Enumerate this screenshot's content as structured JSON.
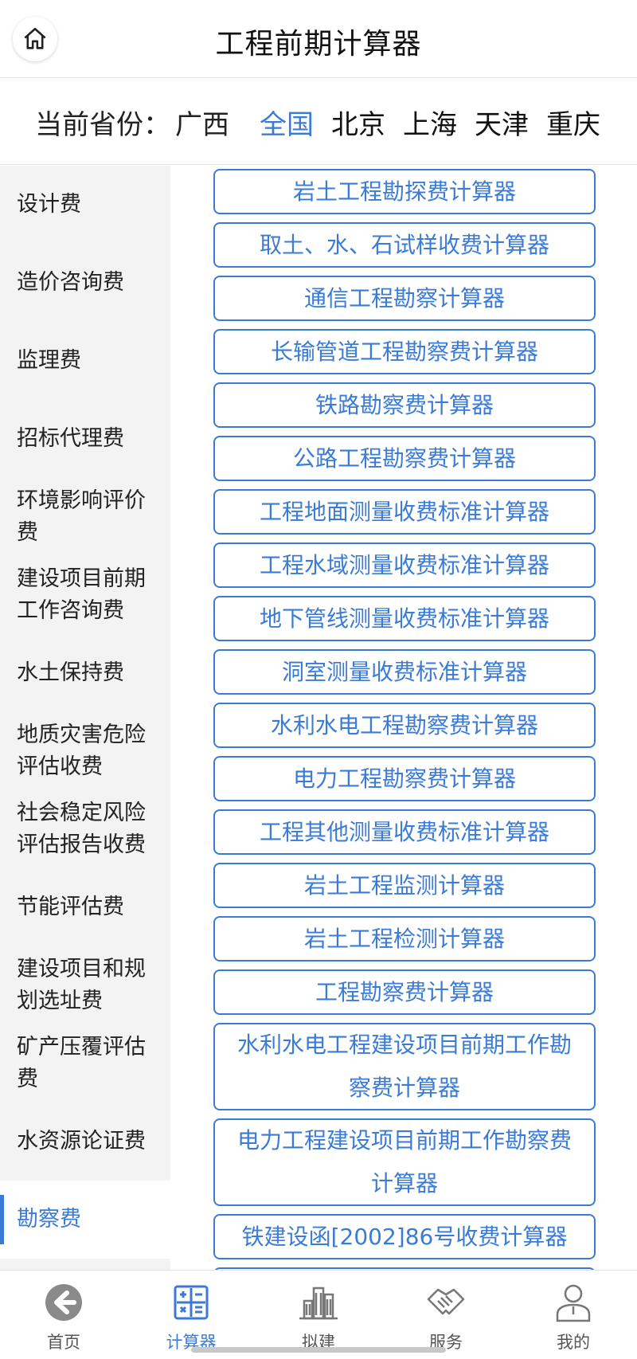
{
  "header": {
    "title": "工程前期计算器",
    "home_icon": "home-icon"
  },
  "province": {
    "label": "当前省份：",
    "current": "广西",
    "options": [
      "全国",
      "北京",
      "上海",
      "天津",
      "重庆"
    ],
    "active_option": "全国"
  },
  "sidebar": {
    "items": [
      {
        "label": "设计费"
      },
      {
        "label": "造价咨询费"
      },
      {
        "label": "监理费"
      },
      {
        "label": "招标代理费"
      },
      {
        "label": "环境影响评价费"
      },
      {
        "label": "建设项目前期工作咨询费"
      },
      {
        "label": "水土保持费"
      },
      {
        "label": "地质灾害危险评估收费"
      },
      {
        "label": "社会稳定风险评估报告收费"
      },
      {
        "label": "节能评估费"
      },
      {
        "label": "建设项目和规划选址费"
      },
      {
        "label": "矿产压覆评估费"
      },
      {
        "label": "水资源论证费"
      },
      {
        "label": "勘察费"
      }
    ],
    "active": "勘察费"
  },
  "calculators": [
    {
      "label": "岩土工程勘探费计算器"
    },
    {
      "label": "取土、水、石试样收费计算器"
    },
    {
      "label": "通信工程勘察计算器"
    },
    {
      "label": "长输管道工程勘察费计算器"
    },
    {
      "label": "铁路勘察费计算器"
    },
    {
      "label": "公路工程勘察费计算器"
    },
    {
      "label": "工程地面测量收费标准计算器"
    },
    {
      "label": "工程水域测量收费标准计算器"
    },
    {
      "label": "地下管线测量收费标准计算器"
    },
    {
      "label": "洞室测量收费标准计算器"
    },
    {
      "label": "水利水电工程勘察费计算器"
    },
    {
      "label": "电力工程勘察费计算器"
    },
    {
      "label": "工程其他测量收费标准计算器"
    },
    {
      "label": "岩土工程监测计算器"
    },
    {
      "label": "岩土工程检测计算器"
    },
    {
      "label": "工程勘察费计算器"
    },
    {
      "label": "水利水电工程建设项目前期工作勘察费计算器"
    },
    {
      "label": "电力工程建设项目前期工作勘察费计算器"
    },
    {
      "label": "铁建设函[2002]86号收费计算器"
    }
  ],
  "tabbar": {
    "tabs": [
      {
        "label": "首页",
        "icon": "home-back-icon"
      },
      {
        "label": "计算器",
        "icon": "calculator-icon"
      },
      {
        "label": "拟建",
        "icon": "buildings-icon"
      },
      {
        "label": "服务",
        "icon": "handshake-icon"
      },
      {
        "label": "我的",
        "icon": "user-icon"
      }
    ],
    "active": "计算器"
  },
  "colors": {
    "accent": "#3a7bd5",
    "sidebar_bg": "#f3f3f3"
  }
}
